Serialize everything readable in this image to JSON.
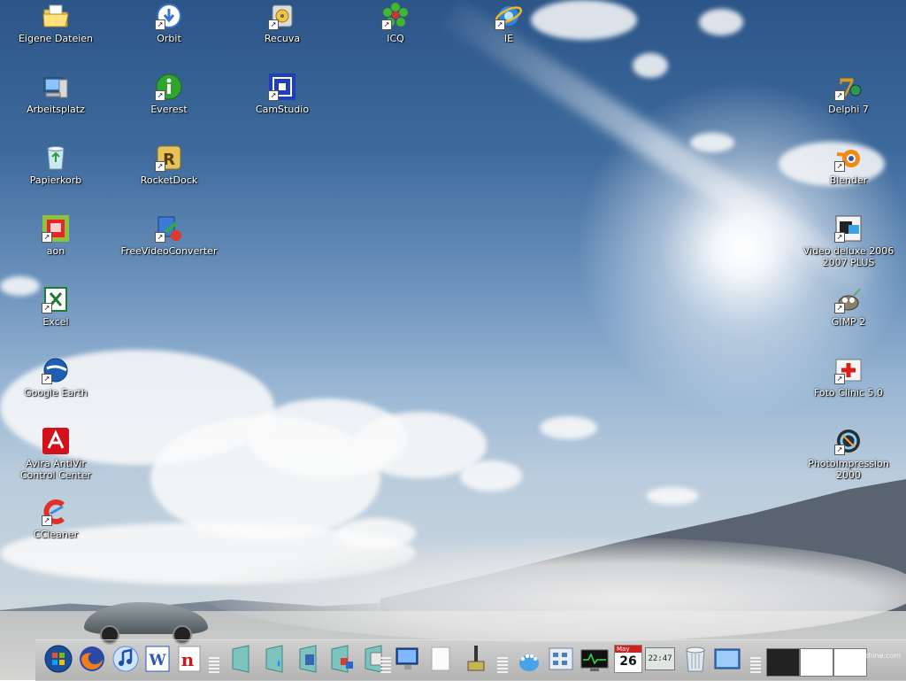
{
  "desktop": {
    "icons": {
      "eigene_dateien": "Eigene Dateien",
      "orbit": "Orbit",
      "recuva": "Recuva",
      "icq": "ICQ",
      "ie": "IE",
      "arbeitsplatz": "Arbeitsplatz",
      "everest": "Everest",
      "camstudio": "CamStudio",
      "delphi7": "Delphi 7",
      "papierkorb": "Papierkorb",
      "rocketdock": "RocketDock",
      "blender": "Blender",
      "aon": "aon",
      "freevideoconverter": "FreeVideoConverter",
      "videodeluxe": "Video deluxe 2006 2007 PLUS",
      "excel": "Excel",
      "gimp2": "GIMP 2",
      "google_earth": "Google Earth",
      "fotoclinic": "Foto Clinic 5.0",
      "avira": "Avira AntiVir Control Center",
      "photoimpression": "PhotoImpression 2000",
      "ccleaner": "CCleaner"
    }
  },
  "dock": {
    "calendar_month": "May",
    "calendar_day": "26",
    "clock_text": "22:47",
    "watermark": "zyzhine.com"
  },
  "colors": {
    "sky_top": "#2c5588",
    "accent_excel": "#1e7b34",
    "accent_avira": "#d2111a"
  }
}
